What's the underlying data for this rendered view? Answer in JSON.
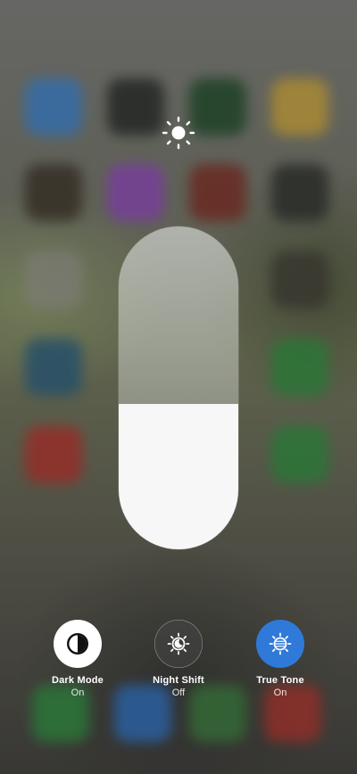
{
  "brightness": {
    "icon": "sun-icon",
    "level": 0.45
  },
  "controls": [
    {
      "label": "Dark Mode",
      "state": "On",
      "icon": "dark-mode-icon",
      "active": true
    },
    {
      "label": "Night Shift",
      "state": "Off",
      "icon": "night-shift-icon",
      "active": false
    },
    {
      "label": "True Tone",
      "state": "On",
      "icon": "true-tone-icon",
      "active": true
    }
  ],
  "colors": {
    "accent": "#2f7ad8",
    "slider_fill": "#f7f7f7",
    "label": "#ffffff"
  }
}
